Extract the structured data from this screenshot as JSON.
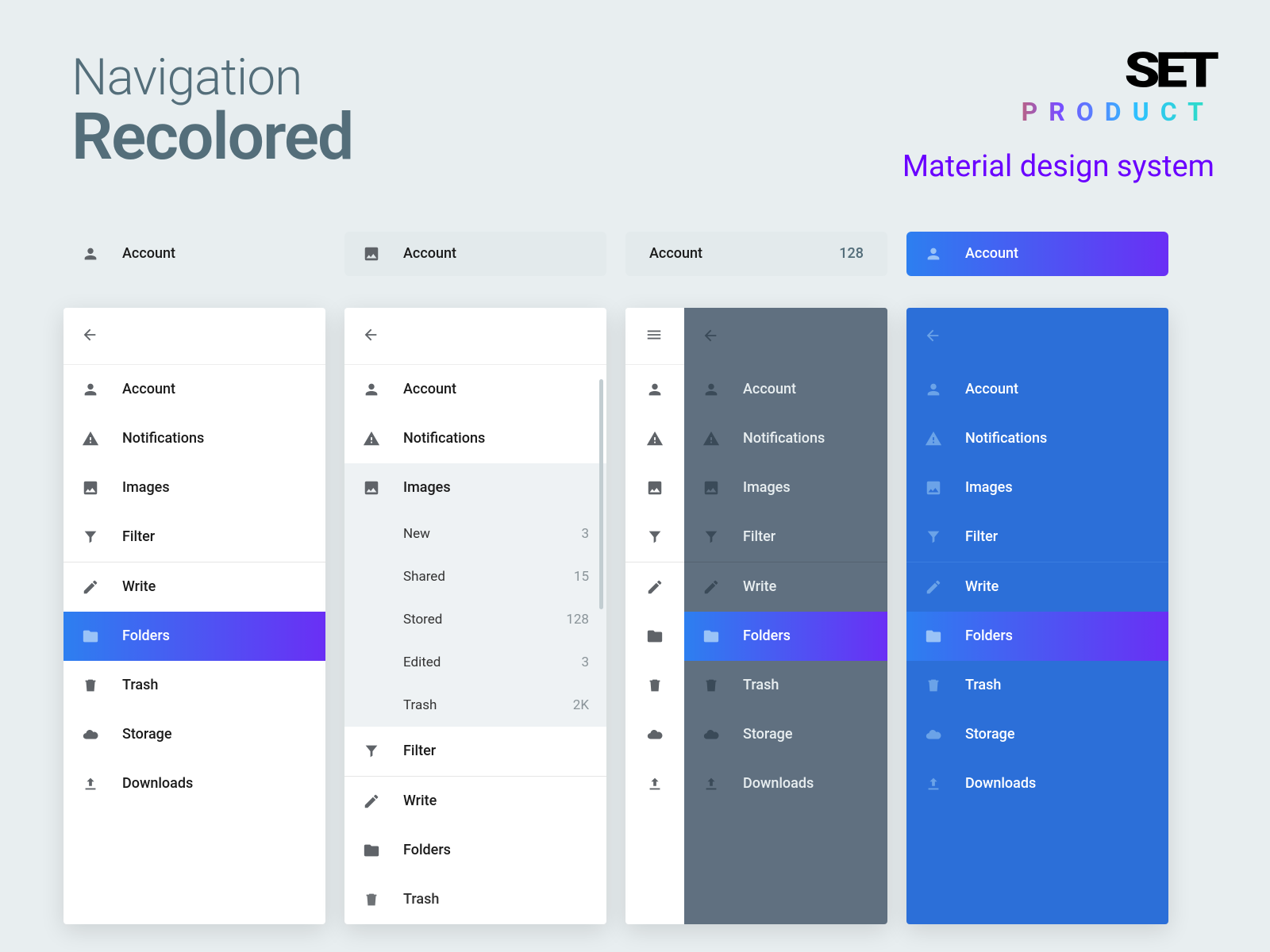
{
  "header": {
    "title1": "Navigation",
    "title2": "Recolored",
    "brand_logo": "SET",
    "brand_sub": "PRODUCT",
    "subtitle": "Material design system"
  },
  "pills": {
    "p1": {
      "label": "Account"
    },
    "p2": {
      "label": "Account"
    },
    "p3": {
      "label": "Account",
      "count": "128"
    },
    "p4": {
      "label": "Account"
    }
  },
  "nav_items": {
    "account": "Account",
    "notifications": "Notifications",
    "images": "Images",
    "filter": "Filter",
    "write": "Write",
    "folders": "Folders",
    "trash": "Trash",
    "storage": "Storage",
    "downloads": "Downloads"
  },
  "sub_items": {
    "new": {
      "label": "New",
      "count": "3"
    },
    "shared": {
      "label": "Shared",
      "count": "15"
    },
    "stored": {
      "label": "Stored",
      "count": "128"
    },
    "edited": {
      "label": "Edited",
      "count": "3"
    },
    "trash": {
      "label": "Trash",
      "count": "2K"
    }
  }
}
